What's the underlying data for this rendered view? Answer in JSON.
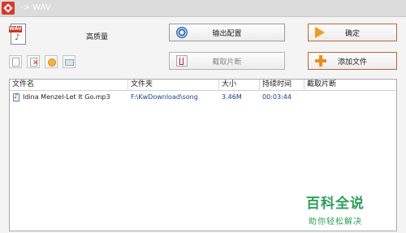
{
  "window": {
    "title": "-> WAV"
  },
  "format": {
    "icon_tag": "WAV",
    "quality_label": "高质量"
  },
  "buttons": {
    "output_config": "输出配置",
    "ok": "确定",
    "cut_clip": "截取片断",
    "add_file": "添加文件"
  },
  "table": {
    "columns": [
      "文件名",
      "文件夹",
      "大小",
      "持续时间",
      "截取片断"
    ],
    "rows": [
      {
        "name": "Idina Menzel-Let It Go.mp3",
        "folder": "F:\\KwDownload\\song",
        "size": "3.46M",
        "duration": "00:03:44",
        "clip": ""
      }
    ]
  },
  "watermark": {
    "main": "百科全说",
    "sub": "助你轻松解决"
  },
  "colors": {
    "accent": "#f08a1c",
    "watermark": "#2e9e5a",
    "app_icon": "#d83a2e"
  }
}
